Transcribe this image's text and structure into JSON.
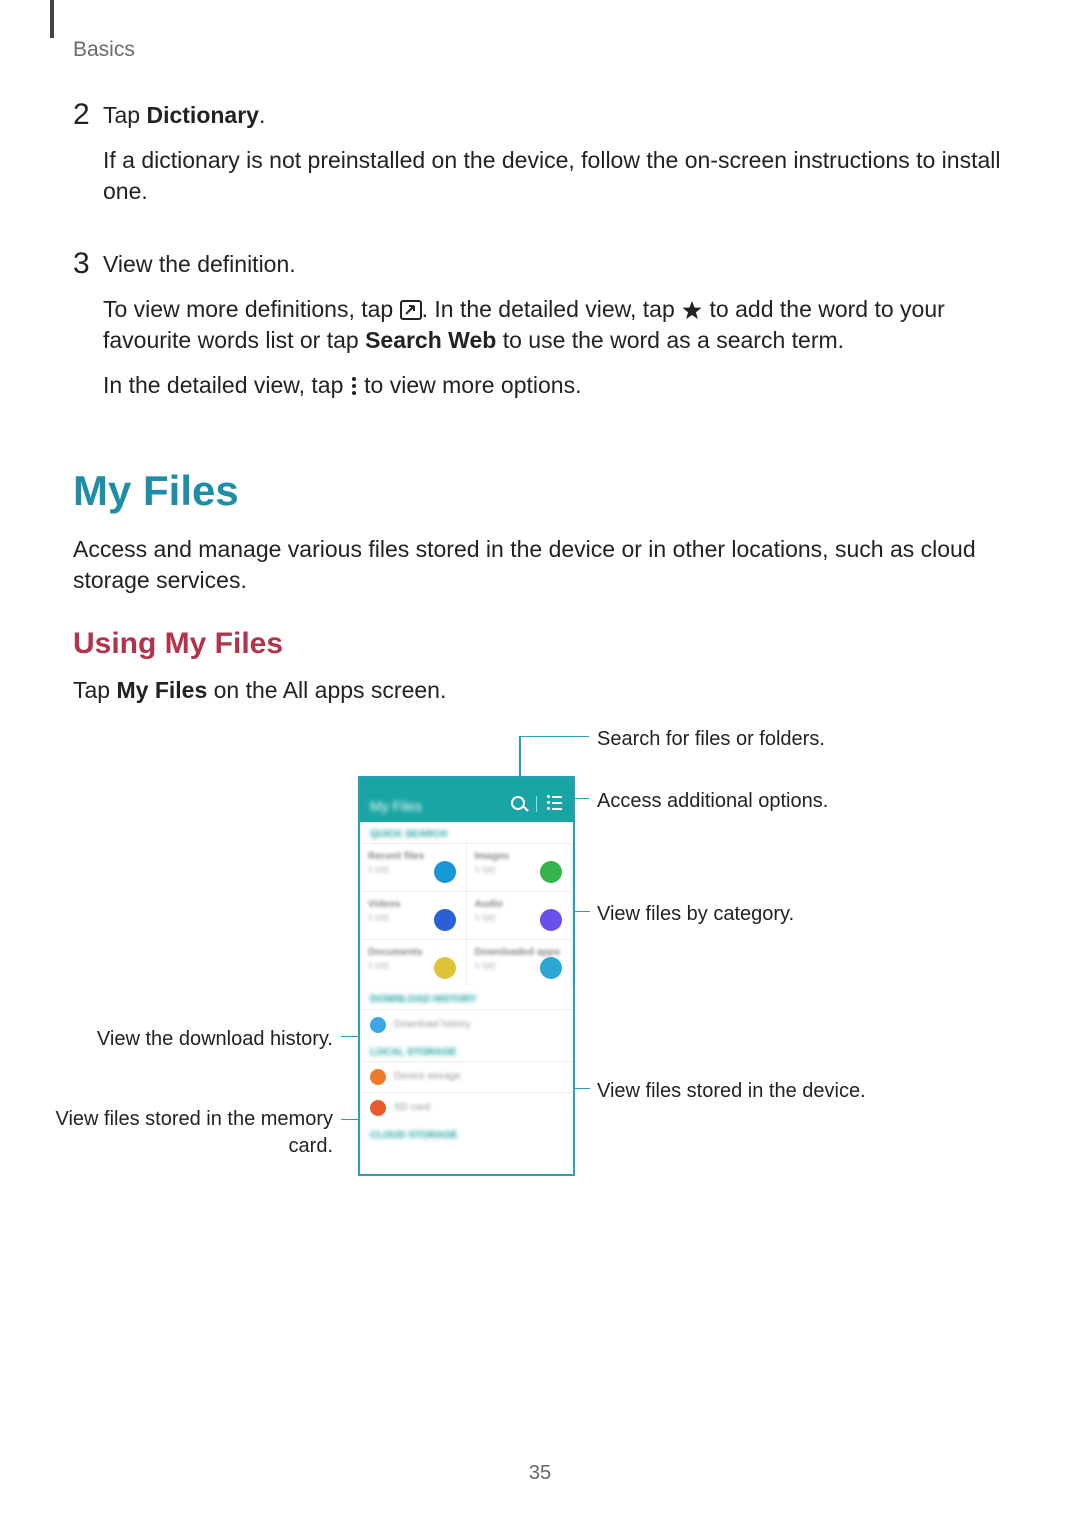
{
  "header": {
    "section": "Basics"
  },
  "steps": {
    "s2": {
      "num": "2",
      "line1_prefix": "Tap ",
      "line1_bold": "Dictionary",
      "line1_suffix": ".",
      "line2": "If a dictionary is not preinstalled on the device, follow the on-screen instructions to install one."
    },
    "s3": {
      "num": "3",
      "line1": "View the definition.",
      "line2_a": "To view more definitions, tap ",
      "line2_b": ". In the detailed view, tap ",
      "line2_c": " to add the word to your favourite words list or tap ",
      "line2_bold": "Search Web",
      "line2_d": " to use the word as a search term.",
      "line3_a": "In the detailed view, tap ",
      "line3_b": " to view more options."
    }
  },
  "myfiles": {
    "title": "My Files",
    "intro": "Access and manage various files stored in the device or in other locations, such as cloud storage services.",
    "using_title": "Using My Files",
    "using_a": "Tap ",
    "using_bold": "My Files",
    "using_b": " on the All apps screen."
  },
  "callouts": {
    "search": "Search for files or folders.",
    "more": "Access additional options.",
    "category": "View files by category.",
    "device": "View files stored in the device.",
    "download": "View the download history.",
    "sdcard": "View files stored in the memory card."
  },
  "phone": {
    "title": "My Files",
    "quick": "QUICK SEARCH",
    "cells": {
      "recent": "Recent files",
      "images": "Images",
      "videos": "Videos",
      "audio": "Audio",
      "documents": "Documents",
      "downloaded": "Downloaded apps"
    },
    "dl_section": "DOWNLOAD HISTORY",
    "dl_row": "Download history",
    "local_section": "LOCAL STORAGE",
    "device_row": "Device storage",
    "sd_row": "SD card",
    "cloud_section": "CLOUD STORAGE"
  },
  "page": "35"
}
